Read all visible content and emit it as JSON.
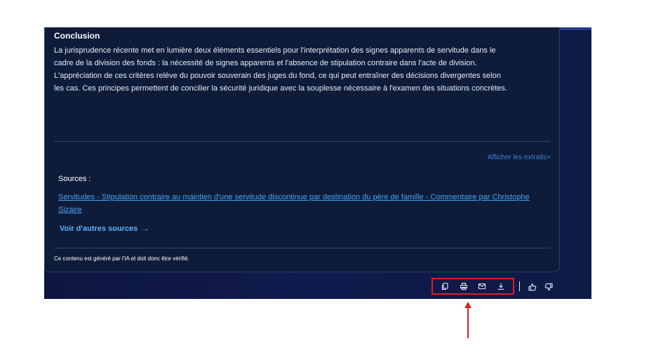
{
  "conclusion": {
    "title": "Conclusion",
    "text": "La jurisprudence récente met en lumière deux éléments essentiels pour l'interprétation des signes apparents de servitude dans le cadre de la division des fonds : la nécessité de signes apparents et l'absence de stipulation contraire dans l'acte de division. L'appréciation de ces critères relève du pouvoir souverain des juges du fond, ce qui peut entraîner des décisions divergentes selon les cas. Ces principes permettent de concilier la sécurité juridique avec la souplesse nécessaire à l'examen des situations concrètes."
  },
  "extracts": {
    "label": "Afficher les extraits",
    "chevron": "˅"
  },
  "sources": {
    "label": "Sources :",
    "items": [
      {
        "title": "Servitudes - Stipulation contraire au maintien d'une servitude discontinue par destination du père de famille - Commentaire par Christophe Sizaire"
      }
    ],
    "more_label": "Voir d'autres sources",
    "more_arrow": "→"
  },
  "disclaimer": "Ce contenu est généré par l'IA et doit donc être vérifié.",
  "toolbar": {
    "icons": [
      "copy-icon",
      "print-icon",
      "mail-icon",
      "download-icon"
    ],
    "feedback_icons": [
      "thumbs-up-icon",
      "thumbs-down-icon"
    ]
  },
  "colors": {
    "background": "#111a4d",
    "card": "#0e1c3a",
    "link": "#4aa3f0",
    "highlight": "#e01e1e"
  }
}
